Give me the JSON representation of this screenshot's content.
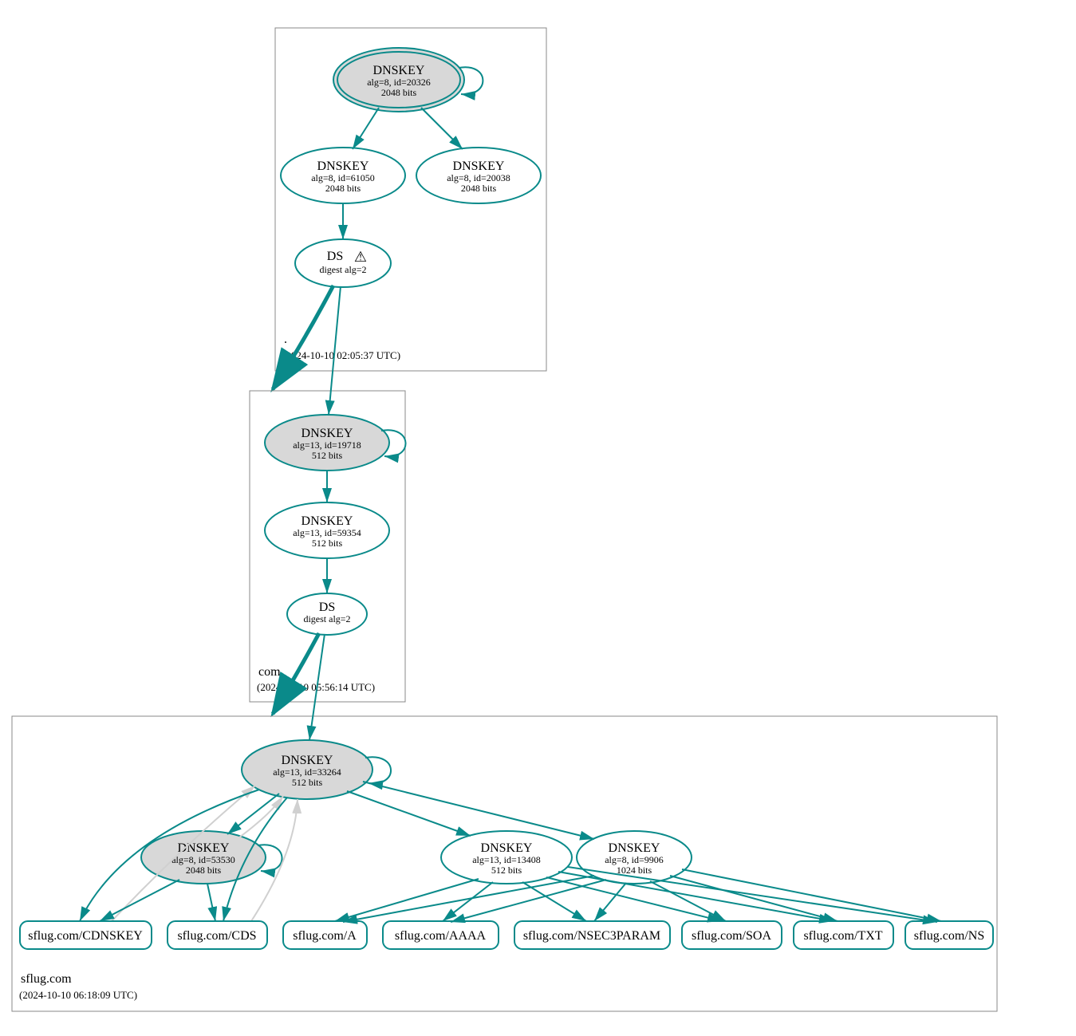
{
  "colors": {
    "teal": "#0a8a8a",
    "grayFill": "#d8d8d8",
    "whiteFill": "#ffffff",
    "boxStroke": "#888888",
    "lightEdge": "#d0d0d0",
    "black": "#000000"
  },
  "zones": {
    "root": {
      "label": ".",
      "timestamp": "(2024-10-10 02:05:37 UTC)"
    },
    "com": {
      "label": "com",
      "timestamp": "(2024-10-10 05:56:14 UTC)"
    },
    "sflug": {
      "label": "sflug.com",
      "timestamp": "(2024-10-10 06:18:09 UTC)"
    }
  },
  "nodes": {
    "root_ksk": {
      "title": "DNSKEY",
      "line2": "alg=8, id=20326",
      "line3": "2048 bits"
    },
    "root_zsk1": {
      "title": "DNSKEY",
      "line2": "alg=8, id=61050",
      "line3": "2048 bits"
    },
    "root_zsk2": {
      "title": "DNSKEY",
      "line2": "alg=8, id=20038",
      "line3": "2048 bits"
    },
    "root_ds": {
      "title": "DS",
      "line2": "digest alg=2",
      "warn": "⚠"
    },
    "com_ksk": {
      "title": "DNSKEY",
      "line2": "alg=13, id=19718",
      "line3": "512 bits"
    },
    "com_zsk": {
      "title": "DNSKEY",
      "line2": "alg=13, id=59354",
      "line3": "512 bits"
    },
    "com_ds": {
      "title": "DS",
      "line2": "digest alg=2"
    },
    "sflug_ksk": {
      "title": "DNSKEY",
      "line2": "alg=13, id=33264",
      "line3": "512 bits"
    },
    "sflug_k2": {
      "title": "DNSKEY",
      "line2": "alg=8, id=53530",
      "line3": "2048 bits"
    },
    "sflug_k3": {
      "title": "DNSKEY",
      "line2": "alg=13, id=13408",
      "line3": "512 bits"
    },
    "sflug_k4": {
      "title": "DNSKEY",
      "line2": "alg=8, id=9906",
      "line3": "1024 bits"
    }
  },
  "rrsets": {
    "cdnskey": "sflug.com/CDNSKEY",
    "cds": "sflug.com/CDS",
    "a": "sflug.com/A",
    "aaaa": "sflug.com/AAAA",
    "nsec3param": "sflug.com/NSEC3PARAM",
    "soa": "sflug.com/SOA",
    "txt": "sflug.com/TXT",
    "ns": "sflug.com/NS"
  }
}
